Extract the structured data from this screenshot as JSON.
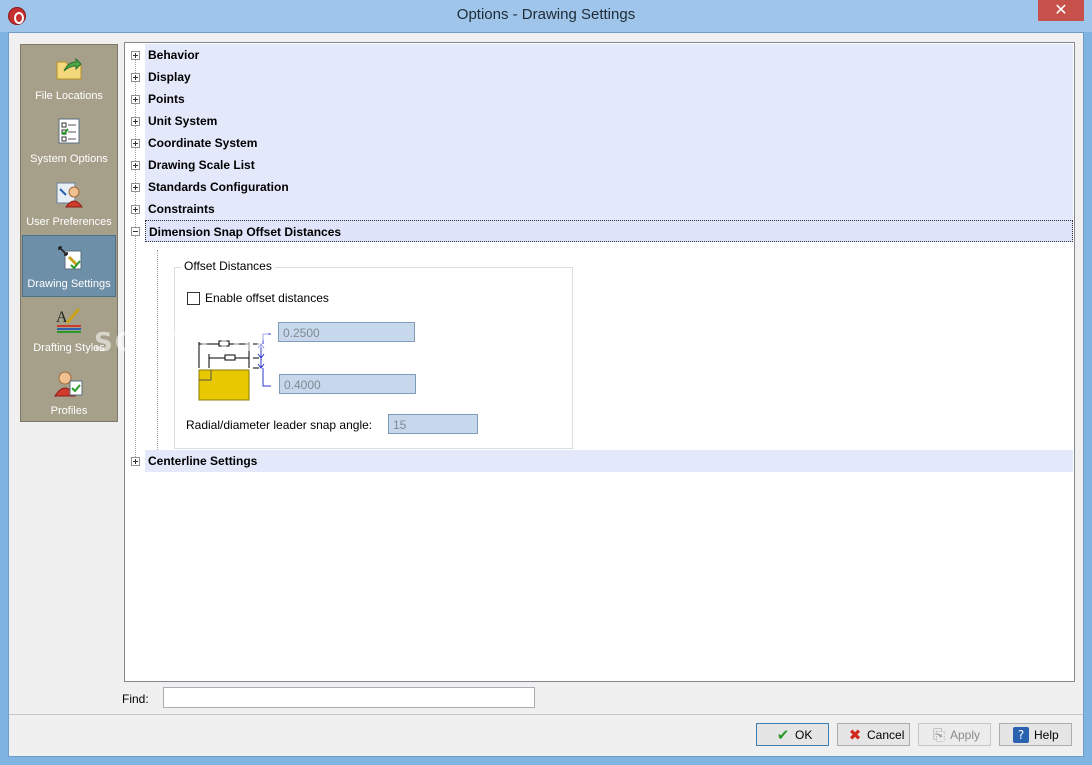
{
  "window": {
    "title": "Options - Drawing Settings",
    "close_glyph": "✕"
  },
  "categories": [
    {
      "label": "File Locations",
      "icon": "folder-arrow-icon"
    },
    {
      "label": "System Options",
      "icon": "checklist-icon"
    },
    {
      "label": "User Preferences",
      "icon": "user-preferences-icon"
    },
    {
      "label": "Drawing Settings",
      "icon": "drawing-settings-icon",
      "active": true
    },
    {
      "label": "Drafting Styles",
      "icon": "drafting-styles-icon"
    },
    {
      "label": "Profiles",
      "icon": "profiles-icon"
    }
  ],
  "tree": {
    "items": [
      {
        "label": "Behavior",
        "expanded": false
      },
      {
        "label": "Display",
        "expanded": false
      },
      {
        "label": "Points",
        "expanded": false
      },
      {
        "label": "Unit System",
        "expanded": false
      },
      {
        "label": "Coordinate System",
        "expanded": false
      },
      {
        "label": "Drawing Scale List",
        "expanded": false
      },
      {
        "label": "Standards Configuration",
        "expanded": false
      },
      {
        "label": "Constraints",
        "expanded": false
      },
      {
        "label": "Dimension Snap Offset Distances",
        "expanded": true,
        "selected": true
      },
      {
        "label": "Centerline Settings",
        "expanded": false
      }
    ]
  },
  "offset_group": {
    "title": "Offset Distances",
    "enable_label": "Enable offset distances",
    "enable_checked": false,
    "offset1_value": "0.2500",
    "offset2_value": "0.4000",
    "radial_label": "Radial/diameter leader snap angle:",
    "radial_value": "15"
  },
  "find": {
    "label": "Find:",
    "value": ""
  },
  "buttons": {
    "ok": "OK",
    "cancel": "Cancel",
    "apply": "Apply",
    "help": "Help"
  },
  "watermark": "SOFTPEDIA"
}
